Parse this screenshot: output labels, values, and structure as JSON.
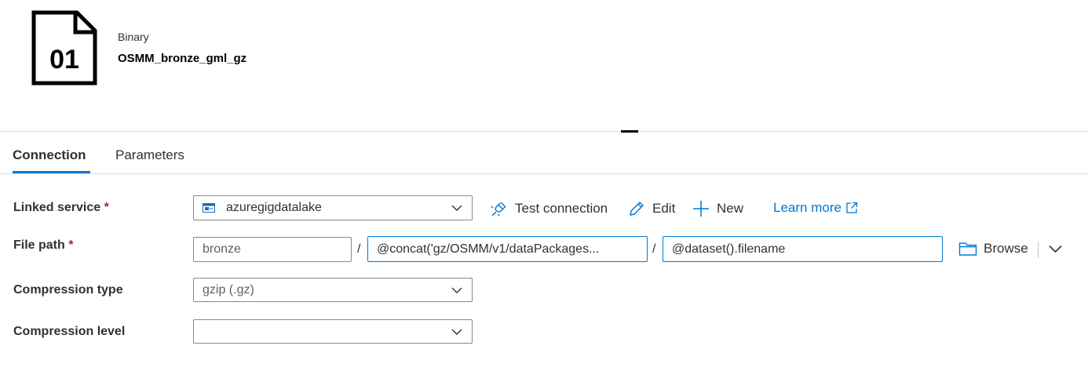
{
  "dataset": {
    "type": "Binary",
    "name": "OSMM_bronze_gml_gz",
    "icon_text": "01"
  },
  "tabs": [
    {
      "label": "Connection",
      "active": true
    },
    {
      "label": "Parameters",
      "active": false
    }
  ],
  "form": {
    "linked_service": {
      "label": "Linked service",
      "required_mark": "*",
      "value": "azuregigdatalake",
      "test_connection": "Test connection",
      "edit": "Edit",
      "new": "New",
      "learn_more": "Learn more"
    },
    "file_path": {
      "label": "File path",
      "required_mark": "*",
      "container": "bronze",
      "separator": "/",
      "directory": "@concat('gz/OSMM/v1/dataPackages...",
      "file_name": "@dataset().filename",
      "browse": "Browse"
    },
    "compression_type": {
      "label": "Compression type",
      "value": "gzip (.gz)"
    },
    "compression_level": {
      "label": "Compression level",
      "value": ""
    }
  },
  "colors": {
    "accent": "#0078d4",
    "required": "#a4262c",
    "border": "#8a8886"
  },
  "icons": [
    "binary-file-icon",
    "storage-service-icon",
    "chevron-down-icon",
    "plug-icon",
    "pencil-icon",
    "plus-icon",
    "external-link-icon",
    "folder-icon"
  ]
}
